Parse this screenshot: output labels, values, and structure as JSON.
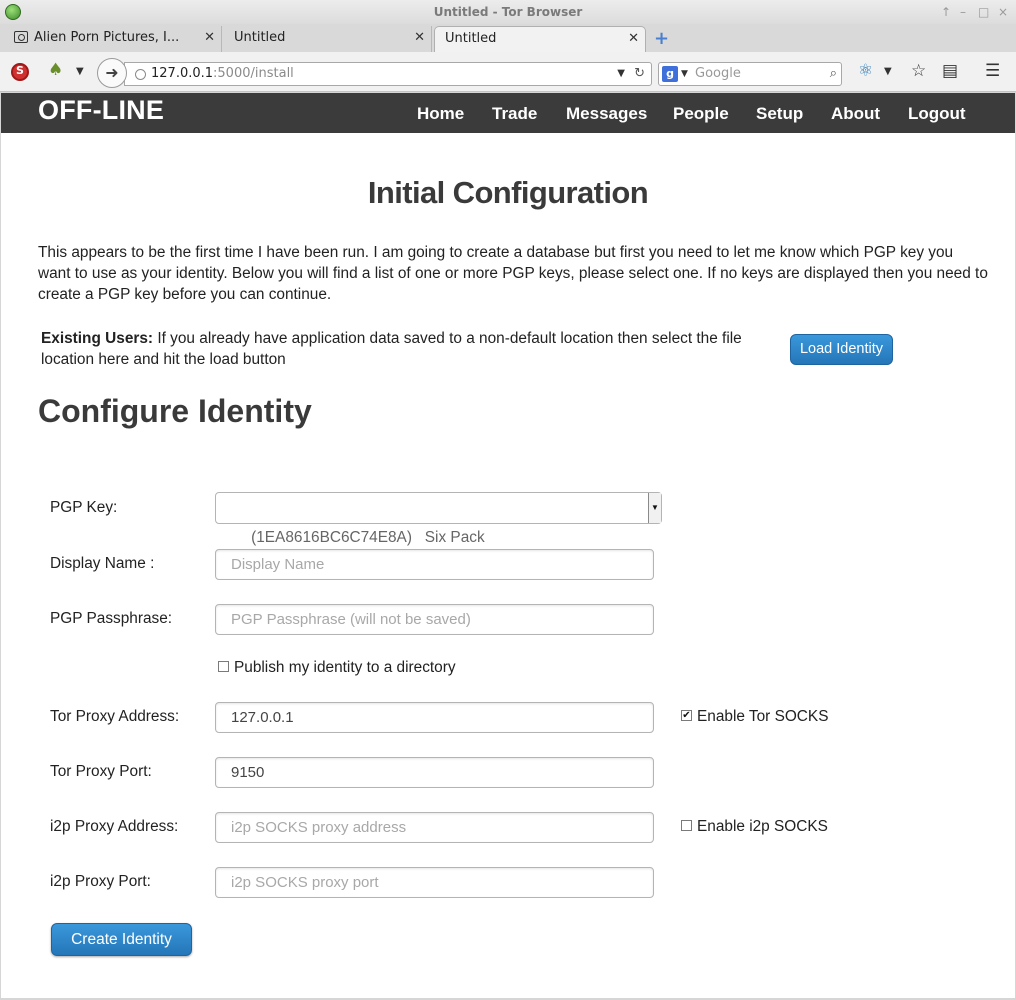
{
  "window": {
    "title": "Untitled - Tor Browser",
    "controls": [
      "↑",
      "–",
      "□",
      "×"
    ]
  },
  "tabs": [
    {
      "label": "Alien Porn Pictures, I...",
      "active": false
    },
    {
      "label": "Untitled",
      "active": false
    },
    {
      "label": "Untitled",
      "active": true
    }
  ],
  "toolbar": {
    "url_host": "127.0.0.1",
    "url_path": ":5000/install",
    "search_placeholder": "Google",
    "search_engine_badge": "g"
  },
  "site": {
    "brand": "OFF-LINE",
    "nav": [
      "Home",
      "Trade",
      "Messages",
      "People",
      "Setup",
      "About",
      "Logout"
    ]
  },
  "main": {
    "heading": "Initial Configuration",
    "intro": "This appears to be the first time I have been run. I am going to create a database but first you need to let me know which PGP key you want to use as your identity. Below you will find a list of one or more PGP keys, please select one. If no keys are displayed then you need to create a PGP key before you can continue.",
    "existing_label": "Existing Users:",
    "existing_text": " If you already have application data saved to a non-default location then select the file location here and hit the load button",
    "load_button": "Load Identity",
    "section_title": "Configure Identity"
  },
  "form": {
    "pgp_key_label": "PGP Key:",
    "pgp_key_value": "(1EA8616BC6C74E8A)   Six Pack",
    "display_name_label": "Display Name :",
    "display_name_placeholder": "Display Name",
    "passphrase_label": "PGP Passphrase:",
    "passphrase_placeholder": "PGP Passphrase (will not be saved)",
    "publish_label": "Publish my identity to a directory",
    "publish_checked": false,
    "tor_address_label": "Tor Proxy Address:",
    "tor_address_value": "127.0.0.1",
    "tor_socks_label": "Enable Tor SOCKS",
    "tor_socks_checked": true,
    "tor_port_label": "Tor Proxy Port:",
    "tor_port_value": "9150",
    "i2p_address_label": "i2p Proxy Address:",
    "i2p_address_placeholder": "i2p SOCKS proxy address",
    "i2p_socks_label": "Enable i2p SOCKS",
    "i2p_socks_checked": false,
    "i2p_port_label": "i2p Proxy Port:",
    "i2p_port_placeholder": "i2p SOCKS proxy port",
    "create_button": "Create Identity"
  }
}
